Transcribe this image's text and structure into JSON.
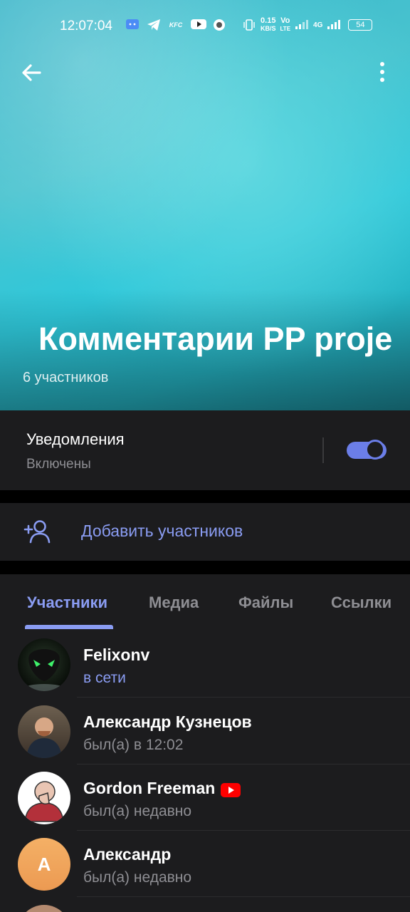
{
  "status_bar": {
    "time": "12:07:04",
    "speed_value": "0.15",
    "speed_unit": "KB/S",
    "volte": "Vo",
    "lte": "LTE",
    "network": "4G",
    "battery": "54"
  },
  "header": {
    "title": "Комментарии PP proje",
    "subtitle": "6 участников"
  },
  "notifications": {
    "label": "Уведомления",
    "status": "Включены",
    "enabled": true
  },
  "add_members": {
    "label": "Добавить участников"
  },
  "tabs": [
    {
      "label": "Участники",
      "active": true
    },
    {
      "label": "Медиа",
      "active": false
    },
    {
      "label": "Файлы",
      "active": false
    },
    {
      "label": "Ссылки",
      "active": false
    }
  ],
  "members": [
    {
      "name": "Felixonv",
      "status": "в сети",
      "online": true
    },
    {
      "name": "Александр Кузнецов",
      "status": "был(а) в 12:02",
      "online": false
    },
    {
      "name": "Gordon Freeman",
      "status": "был(а) недавно",
      "online": false,
      "badge": "youtube-icon"
    },
    {
      "name": "Александр",
      "status": "был(а) недавно",
      "online": false,
      "avatar_letter": "А",
      "avatar_color": "#f0a45a"
    }
  ],
  "colors": {
    "accent": "#8a9cf2",
    "background": "#1c1c1e",
    "secondary_text": "#8e8e93"
  }
}
